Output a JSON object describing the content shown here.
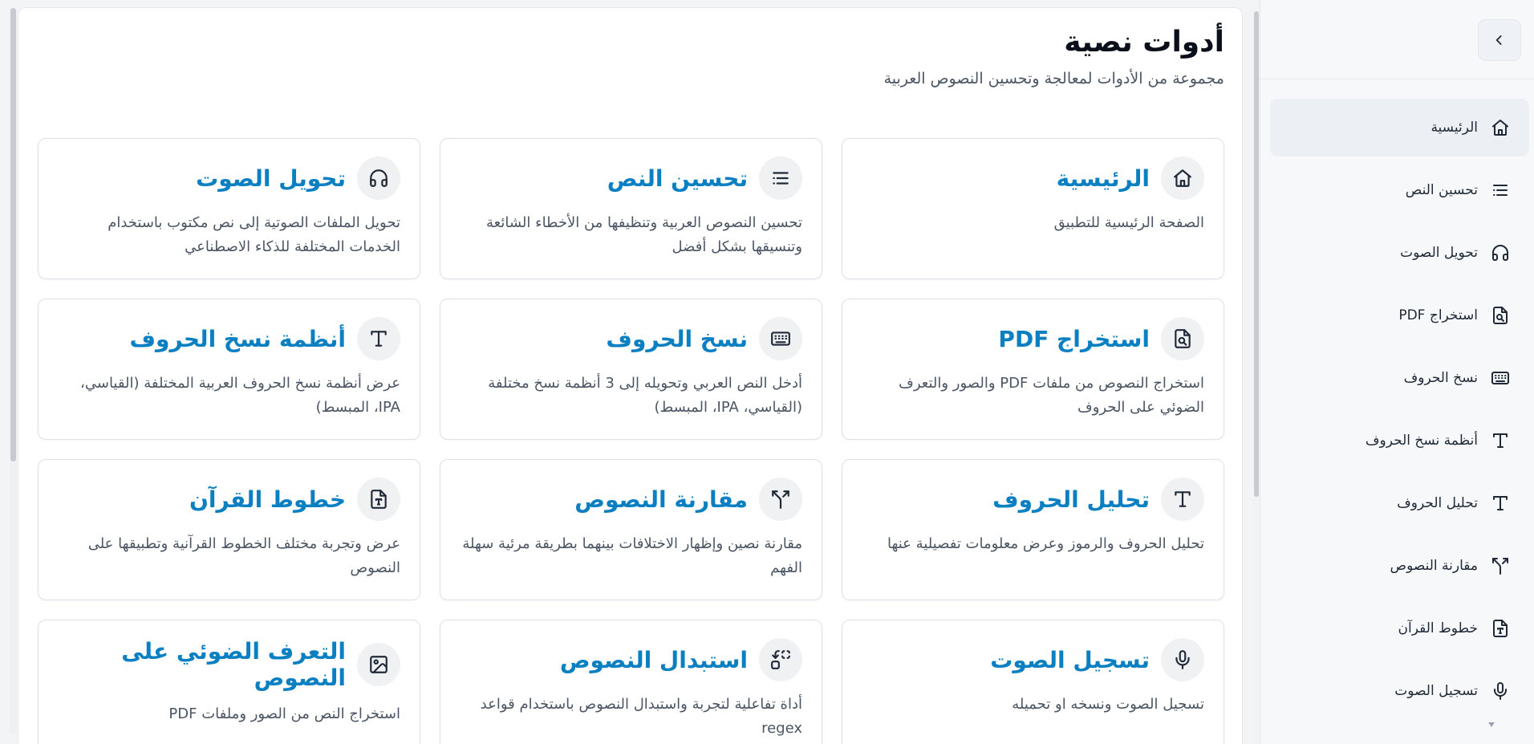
{
  "page": {
    "title": "أدوات نصية",
    "subtitle": "مجموعة من الأدوات لمعالجة وتحسين النصوص العربية"
  },
  "sidebar": {
    "items": [
      {
        "label": "الرئيسية",
        "icon": "home-icon",
        "active": true
      },
      {
        "label": "تحسين النص",
        "icon": "text-lines-icon"
      },
      {
        "label": "تحويل الصوت",
        "icon": "headphones-icon"
      },
      {
        "label": "استخراج PDF",
        "icon": "file-scan-icon"
      },
      {
        "label": "نسخ الحروف",
        "icon": "keyboard-icon"
      },
      {
        "label": "أنظمة نسخ الحروف",
        "icon": "type-icon"
      },
      {
        "label": "تحليل الحروف",
        "icon": "type-icon"
      },
      {
        "label": "مقارنة النصوص",
        "icon": "split-icon"
      },
      {
        "label": "خطوط القرآن",
        "icon": "file-type-icon"
      },
      {
        "label": "تسجيل الصوت",
        "icon": "microphone-icon"
      }
    ]
  },
  "cards": [
    {
      "title": "الرئيسية",
      "desc": "الصفحة الرئيسية للتطبيق",
      "icon": "home-icon"
    },
    {
      "title": "تحسين النص",
      "desc": "تحسين النصوص العربية وتنظيفها من الأخطاء الشائعة وتنسيقها بشكل أفضل",
      "icon": "text-lines-icon"
    },
    {
      "title": "تحويل الصوت",
      "desc": "تحويل الملفات الصوتية إلى نص مكتوب باستخدام الخدمات المختلفة للذكاء الاصطناعي",
      "icon": "headphones-icon"
    },
    {
      "title": "استخراج PDF",
      "desc": "استخراج النصوص من ملفات PDF والصور والتعرف الضوئي على الحروف",
      "icon": "file-scan-icon"
    },
    {
      "title": "نسخ الحروف",
      "desc": "أدخل النص العربي وتحويله إلى 3 أنظمة نسخ مختلفة (القياسي، IPA، المبسط)",
      "icon": "keyboard-icon"
    },
    {
      "title": "أنظمة نسخ الحروف",
      "desc": "عرض أنظمة نسخ الحروف العربية المختلفة (القياسي، IPA، المبسط)",
      "icon": "type-icon"
    },
    {
      "title": "تحليل الحروف",
      "desc": "تحليل الحروف والرموز وعرض معلومات تفصيلية عنها",
      "icon": "type-icon"
    },
    {
      "title": "مقارنة النصوص",
      "desc": "مقارنة نصين وإظهار الاختلافات بينهما بطريقة مرئية سهلة الفهم",
      "icon": "split-icon"
    },
    {
      "title": "خطوط القرآن",
      "desc": "عرض وتجربة مختلف الخطوط القرآنية وتطبيقها على النصوص",
      "icon": "file-type-icon"
    },
    {
      "title": "تسجيل الصوت",
      "desc": "تسجيل الصوت ونسخه او تحميله",
      "icon": "microphone-icon"
    },
    {
      "title": "استبدال النصوص",
      "desc": "أداة تفاعلية لتجربة واستبدال النصوص باستخدام قواعد regex",
      "icon": "replace-icon"
    },
    {
      "title": "التعرف الضوئي على النصوص",
      "desc": "استخراج النص من الصور وملفات PDF",
      "icon": "image-icon"
    }
  ],
  "controls": {
    "settings_icon": "gear-icon",
    "collapse_icon": "chevron-right-icon"
  },
  "colors": {
    "accent": "#0a7fc2",
    "icon_bg": "#f0f1f3",
    "active_nav_bg": "#eceff3"
  }
}
